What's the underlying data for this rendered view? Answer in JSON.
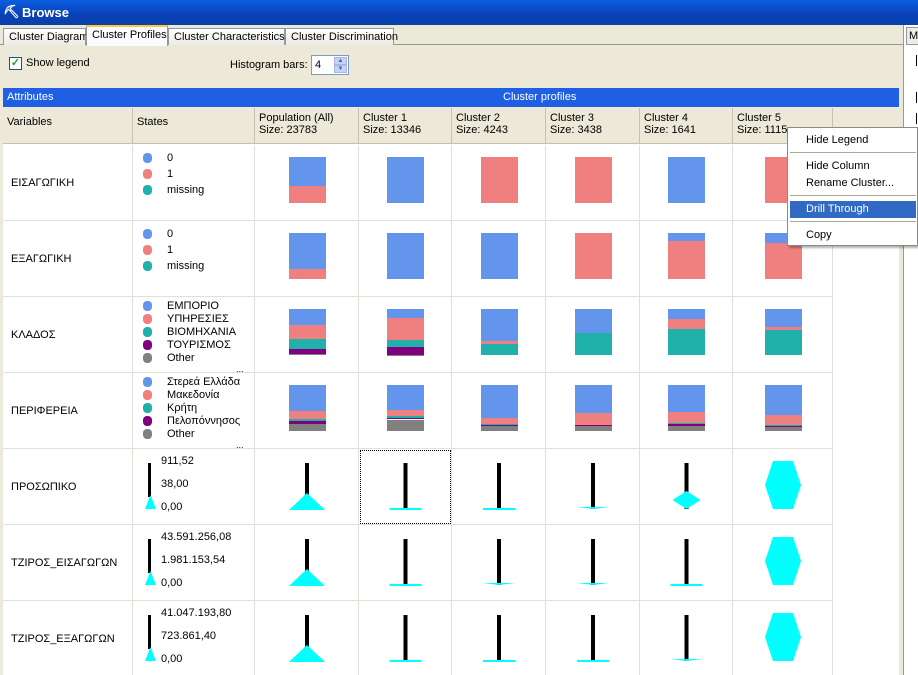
{
  "window": {
    "title": "Browse"
  },
  "tabs": [
    {
      "label": "Cluster Diagram",
      "active": false
    },
    {
      "label": "Cluster Profiles",
      "active": true
    },
    {
      "label": "Cluster Characteristics",
      "active": false
    },
    {
      "label": "Cluster Discrimination",
      "active": false
    }
  ],
  "right_panel": {
    "tab_label": "M"
  },
  "options": {
    "show_legend_label": "Show legend",
    "show_legend_checked": true,
    "histogram_label": "Histogram bars:",
    "histogram_value": "4"
  },
  "header_bar": {
    "attributes_label": "Attributes",
    "cluster_profiles_label": "Cluster profiles"
  },
  "columns": {
    "variables": "Variables",
    "states": "States",
    "clusters": [
      {
        "name": "Population (All)",
        "size": "Size: 23783"
      },
      {
        "name": "Cluster 1",
        "size": "Size: 13346"
      },
      {
        "name": "Cluster 2",
        "size": "Size: 4243"
      },
      {
        "name": "Cluster 3",
        "size": "Size: 3438"
      },
      {
        "name": "Cluster 4",
        "size": "Size: 1641"
      },
      {
        "name": "Cluster 5",
        "size": "Size: 1115"
      }
    ]
  },
  "colors": {
    "blue": "#6495ed",
    "salmon": "#f08080",
    "teal": "#20b2aa",
    "purple": "#800080",
    "gray": "#808080",
    "cyan": "#00ffff",
    "accent": "#1e5fe4"
  },
  "rows": [
    {
      "variable": "ΕΙΣΑΓΩΓΙΚΗ",
      "type": "discrete",
      "states": [
        {
          "label": "0",
          "color": "#6495ed"
        },
        {
          "label": "1",
          "color": "#f08080"
        },
        {
          "label": "missing",
          "color": "#20b2aa"
        }
      ],
      "more_states": false,
      "distributions": [
        [
          0.63,
          0.37,
          0
        ],
        [
          1.0,
          0,
          0
        ],
        [
          0,
          1.0,
          0
        ],
        [
          0,
          1.0,
          0
        ],
        [
          1.0,
          0,
          0
        ],
        [
          0,
          1.0,
          0
        ]
      ]
    },
    {
      "variable": "ΕΞΑΓΩΓΙΚΗ",
      "type": "discrete",
      "states": [
        {
          "label": "0",
          "color": "#6495ed"
        },
        {
          "label": "1",
          "color": "#f08080"
        },
        {
          "label": "missing",
          "color": "#20b2aa"
        }
      ],
      "more_states": false,
      "distributions": [
        [
          0.78,
          0.22,
          0
        ],
        [
          1.0,
          0,
          0
        ],
        [
          1.0,
          0,
          0
        ],
        [
          0,
          1.0,
          0
        ],
        [
          0.17,
          0.83,
          0
        ],
        [
          0.22,
          0.78,
          0
        ]
      ]
    },
    {
      "variable": "ΚΛΑΔΟΣ",
      "type": "discrete",
      "states": [
        {
          "label": "ΕΜΠΟΡΙΟ",
          "color": "#6495ed"
        },
        {
          "label": "ΥΠΗΡΕΣΙΕΣ",
          "color": "#f08080"
        },
        {
          "label": "ΒΙΟΜΗΧΑΝΙΑ",
          "color": "#20b2aa"
        },
        {
          "label": "ΤΟΥΡΙΣΜΟΣ",
          "color": "#800080"
        },
        {
          "label": "Other",
          "color": "#808080"
        }
      ],
      "more_states": true,
      "more_states_text": "...",
      "distributions": [
        [
          0.35,
          0.3,
          0.22,
          0.1,
          0.03
        ],
        [
          0.2,
          0.48,
          0.14,
          0.17,
          0.01
        ],
        [
          0.7,
          0.07,
          0.23,
          0,
          0
        ],
        [
          0.52,
          0.01,
          0.47,
          0,
          0
        ],
        [
          0.22,
          0.22,
          0.56,
          0,
          0
        ],
        [
          0.4,
          0.06,
          0.54,
          0,
          0
        ]
      ]
    },
    {
      "variable": "ΠΕΡΙΦΕΡΕΙΑ",
      "type": "discrete",
      "states": [
        {
          "label": "Στερεά Ελλάδα",
          "color": "#6495ed"
        },
        {
          "label": "Μακεδονία",
          "color": "#f08080"
        },
        {
          "label": "Κρήτη",
          "color": "#20b2aa"
        },
        {
          "label": "Πελοπόννησος",
          "color": "#800080"
        },
        {
          "label": "Other",
          "color": "#808080"
        }
      ],
      "more_states": true,
      "more_states_text": "...",
      "distributions": [
        [
          0.57,
          0.17,
          0.05,
          0.05,
          0.16
        ],
        [
          0.55,
          0.12,
          0.04,
          0.04,
          0.25
        ],
        [
          0.72,
          0.12,
          0.03,
          0.03,
          0.1
        ],
        [
          0.6,
          0.26,
          0.02,
          0.02,
          0.1
        ],
        [
          0.58,
          0.25,
          0.02,
          0.05,
          0.1
        ],
        [
          0.65,
          0.23,
          0.01,
          0.03,
          0.08
        ]
      ]
    },
    {
      "variable": "ΠΡΟΣΩΠΙΚΟ",
      "type": "continuous",
      "values": [
        "911,52",
        "38,00",
        "0,00"
      ],
      "profiles": [
        "cone-large",
        "flat",
        "flat",
        "flat-small",
        "cone-mid",
        "hexagon"
      ]
    },
    {
      "variable": "ΤΖΙΡΟΣ_ΕΙΣΑΓΩΓΩΝ",
      "type": "continuous",
      "values": [
        "43.591.256,08",
        "1.981.153,54",
        "0,00"
      ],
      "profiles": [
        "cone-large",
        "flat",
        "flat-small",
        "flat-small",
        "flat",
        "hexagon"
      ]
    },
    {
      "variable": "ΤΖΙΡΟΣ_ΕΞΑΓΩΓΩΝ",
      "type": "continuous",
      "values": [
        "41.047.193,80",
        "723.861,40",
        "0,00"
      ],
      "profiles": [
        "cone-large",
        "flat",
        "flat",
        "flat",
        "flat-small",
        "hexagon"
      ]
    }
  ],
  "context_menu": {
    "items": [
      {
        "label": "Hide Legend",
        "highlighted": false
      },
      {
        "label": "Hide Column",
        "highlighted": false
      },
      {
        "label": "Rename Cluster...",
        "highlighted": false
      },
      {
        "label": "Drill Through",
        "highlighted": true
      },
      {
        "label": "Copy",
        "highlighted": false
      }
    ]
  }
}
